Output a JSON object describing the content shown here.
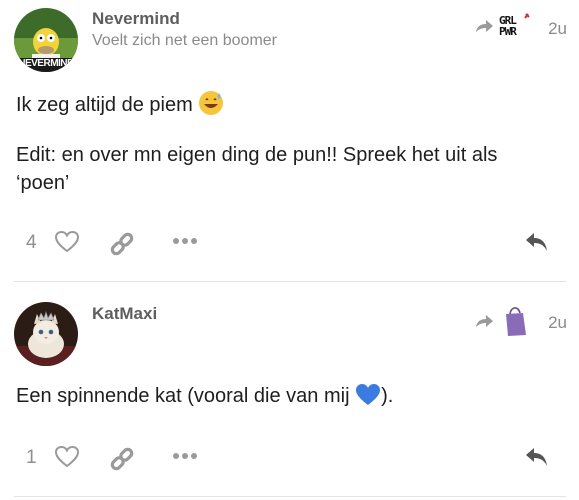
{
  "posts": [
    {
      "username": "Nevermind",
      "user_title": "Voelt zich net een boomer",
      "avatar_text": "NEVERMIND",
      "flair_text": "GRL PWR",
      "time": "2u",
      "paragraphs": [
        "Ik zeg altijd de piem",
        "Edit: en over mn eigen ding de pun!! Spreek het uit als",
        "‘poen’"
      ],
      "like_count": "4"
    },
    {
      "username": "KatMaxi",
      "user_title": "",
      "time": "2u",
      "paragraphs": [
        "Een spinnende kat (vooral die van mij",
        ")."
      ],
      "like_count": "1"
    }
  ],
  "colors": {
    "icon_gray": "#9a9a9a",
    "reply_dark": "#555555",
    "heart_emoji": "#3b7be0"
  }
}
